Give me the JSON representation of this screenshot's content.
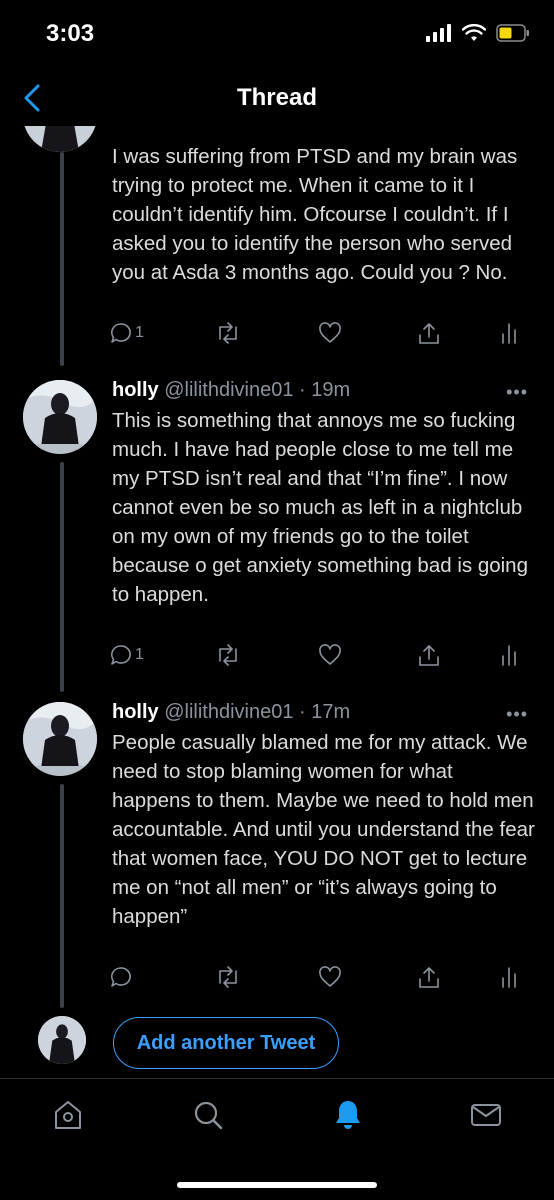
{
  "status": {
    "time": "3:03"
  },
  "nav": {
    "title": "Thread"
  },
  "tweets": [
    {
      "text": "I was suffering from PTSD and my brain was trying to protect me. When it came to it I couldn’t identify him. Ofcourse I couldn’t. If I asked you to identify the person who served you at Asda 3 months ago. Could you ? No.",
      "reply_count": "1"
    },
    {
      "name": "holly",
      "handle": "@lilithdivine01 · 19m",
      "text": "This is something that annoys me so fucking much. I have had people close to me tell me my PTSD isn’t real and that “I’m fine”. I now cannot even be so much as left in a nightclub on my own of my friends go to the toilet because o get anxiety something bad is going to happen.",
      "reply_count": "1"
    },
    {
      "name": "holly",
      "handle": "@lilithdivine01 · 17m",
      "text": "People casually blamed me for my attack. We need to stop blaming women for what happens to them. Maybe we need to hold men accountable. And until you understand the fear that women face, YOU DO NOT get to lecture me on “not all men” or “it’s always going to happen”",
      "reply_count": ""
    }
  ],
  "compose": {
    "button_label": "Add another Tweet"
  },
  "icons": {
    "back": "chevron-left-icon",
    "reply": "speech-bubble-icon",
    "retweet": "retweet-icon",
    "like": "heart-icon",
    "share": "share-icon",
    "analytics": "bar-chart-icon",
    "more": "ellipsis-icon",
    "tabs": [
      "home-icon",
      "search-icon",
      "bell-icon",
      "mail-icon"
    ]
  },
  "colors": {
    "accent": "#1d9bf0",
    "muted": "#8b949e",
    "background": "#000000"
  }
}
